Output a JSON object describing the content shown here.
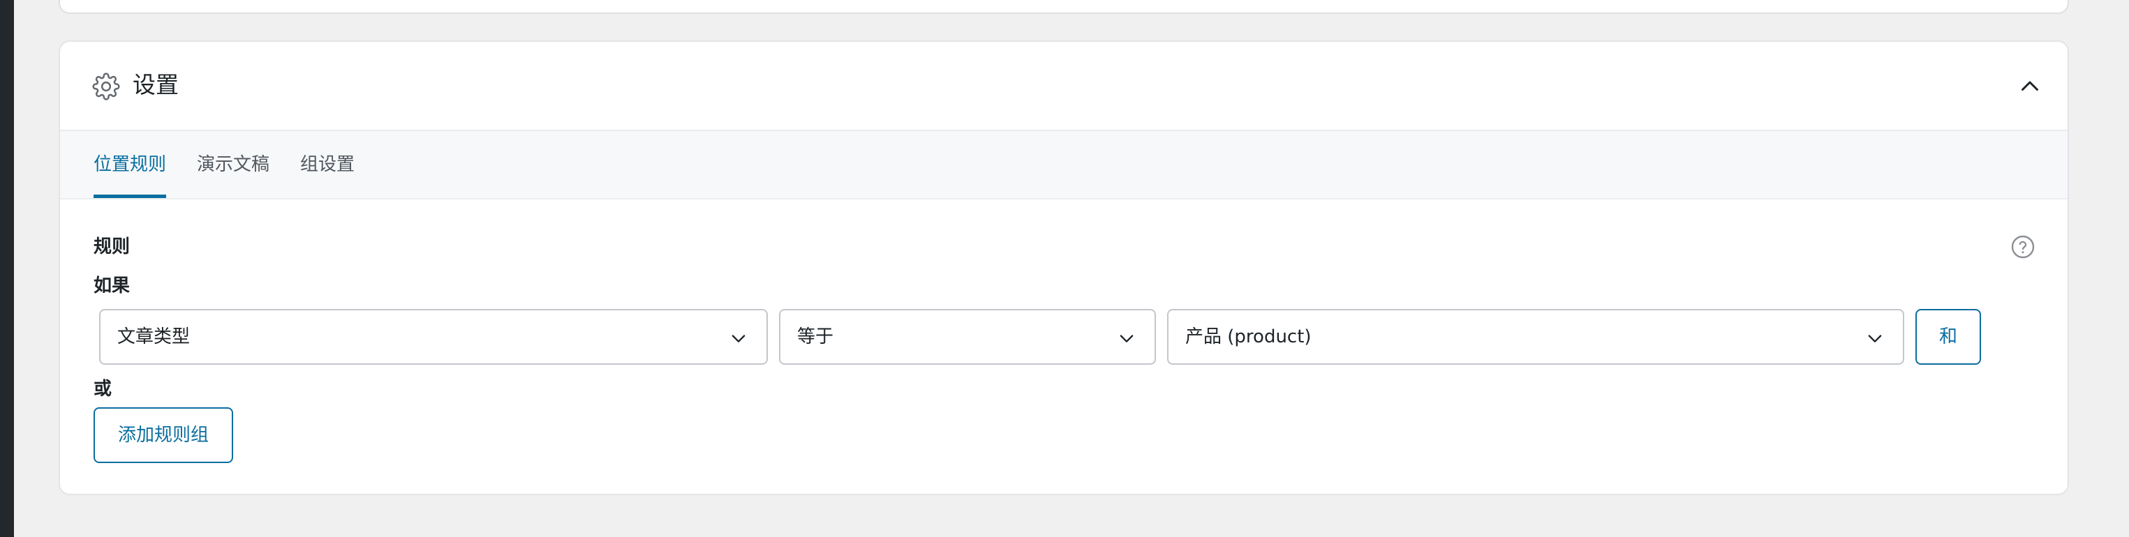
{
  "settings_card": {
    "title": "设置",
    "icon": "gear-icon",
    "collapse_icon": "chevron-up-icon"
  },
  "tabs": [
    {
      "label": "位置规则",
      "active": true
    },
    {
      "label": "演示文稿",
      "active": false
    },
    {
      "label": "组设置",
      "active": false
    }
  ],
  "rules": {
    "section_label": "规则",
    "if_label": "如果",
    "condition": {
      "param": "文章类型",
      "operator": "等于",
      "value": "产品 (product)"
    },
    "and_button": "和",
    "or_label": "或",
    "add_group_button": "添加规则组",
    "help_icon": "help-icon"
  },
  "colors": {
    "accent": "#0a6ea0",
    "background": "#f0f0f1",
    "card": "#ffffff",
    "tabs_bg": "#f7f8f9"
  }
}
